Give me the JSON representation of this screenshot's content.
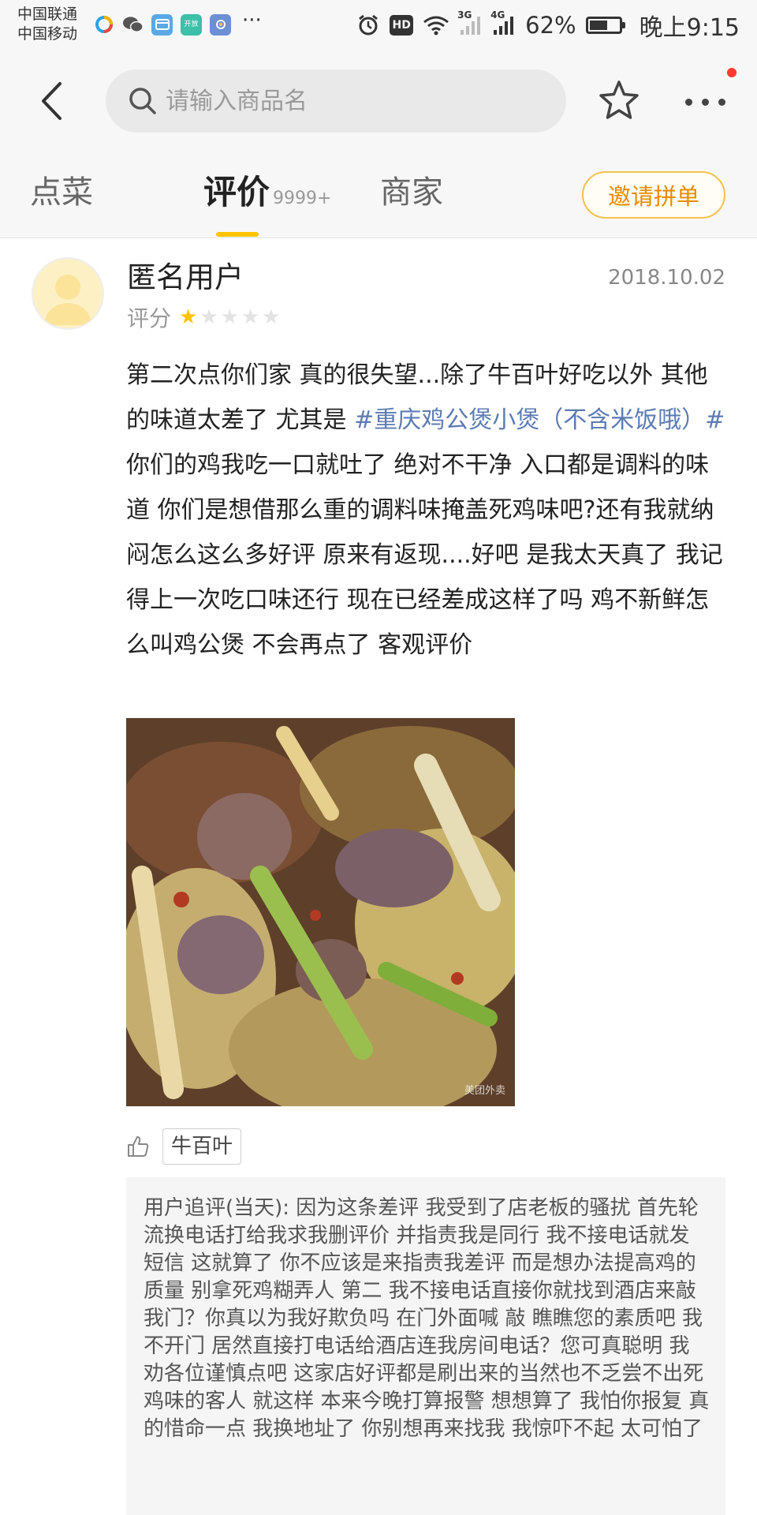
{
  "status_bar": {
    "carrier_1": "中国联通",
    "carrier_2": "中国移动",
    "signal_1": "3G",
    "signal_2": "4G",
    "hd": "HD",
    "battery_text": "62%",
    "battery_level": 0.62,
    "time": "晚上9:15",
    "app_icons": [
      "browser-icon",
      "wechat-icon",
      "card-icon",
      "opengov-icon",
      "baidu-icon"
    ],
    "opengov_label": "开放"
  },
  "nav": {
    "search_placeholder": "请输入商品名"
  },
  "tabs": {
    "order": "点菜",
    "reviews": "评价",
    "reviews_count": "9999+",
    "merchant": "商家",
    "invite": "邀请拼单"
  },
  "review": {
    "user_name": "匿名用户",
    "date": "2018.10.02",
    "score_label": "评分",
    "rating": 1,
    "rating_max": 5,
    "text_part1": "第二次点你们家 真的很失望...除了牛百叶好吃以外 其他的味道太差了 尤其是 ",
    "hashtag": "#重庆鸡公煲小煲（不含米饭哦）#",
    "text_part2": "你们的鸡我吃一口就吐了 绝对不干净 入口都是调料的味道 你们是想借那么重的调料味掩盖死鸡味吧?还有我就纳闷怎么这么多好评 原来有返现....好吧 是我太天真了 我记得上一次吃口味还行 现在已经差成这样了吗 鸡不新鲜怎么叫鸡公煲 不会再点了 客观评价",
    "photo_watermark": "美团外卖",
    "liked_dish": "牛百叶",
    "followup": "用户追评(当天): 因为这条差评 我受到了店老板的骚扰 首先轮流换电话打给我求我删评价 并指责我是同行 我不接电话就发短信 这就算了 你不应该是来指责我差评 而是想办法提高鸡的质量 别拿死鸡糊弄人 第二 我不接电话直接你就找到酒店来敲我门？你真以为我好欺负吗 在门外面喊 敲 瞧瞧您的素质吧 我不开门 居然直接打电话给酒店连我房间电话？您可真聪明 我劝各位谨慎点吧 这家店好评都是刷出来的当然也不乏尝不出死鸡味的客人  就这样 本来今晚打算报警 想想算了 我怕你报复 真的惜命一点 我换地址了 你别想再来找我 我惊吓不起 太可怕了"
  },
  "colors": {
    "accent_yellow": "#ffc300",
    "hashtag_blue": "#5c7bb3",
    "invite_orange": "#e88b00",
    "notification_red": "#ff3b30"
  }
}
